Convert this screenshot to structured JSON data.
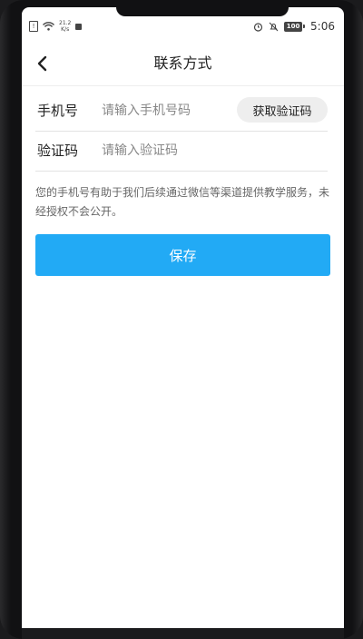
{
  "status_bar": {
    "net_speed_value": "21.2",
    "net_speed_unit": "K/s",
    "battery": "100",
    "time": "5:06"
  },
  "header": {
    "title": "联系方式"
  },
  "form": {
    "phone_label": "手机号",
    "phone_placeholder": "请输入手机号码",
    "get_code_label": "获取验证码",
    "code_label": "验证码",
    "code_placeholder": "请输入验证码"
  },
  "notice": "您的手机号有助于我们后续通过微信等渠道提供教学服务，未经授权不会公开。",
  "save_label": "保存",
  "colors": {
    "primary": "#22aaf5",
    "code_button_bg": "#eeeeee",
    "text": "#222222",
    "hint": "#888888"
  }
}
